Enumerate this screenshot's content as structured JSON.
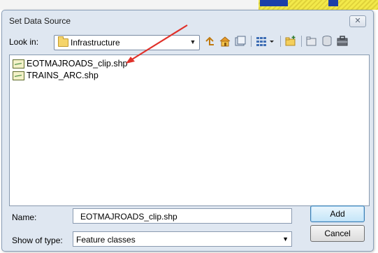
{
  "dialog": {
    "title": "Set Data Source",
    "close_glyph": "✕",
    "look_in": {
      "label": "Look in:",
      "value": "Infrastructure",
      "dropdown_glyph": "▼"
    },
    "toolbar": {
      "icons": [
        "up-one-level-icon",
        "home-icon",
        "catalog-icon",
        "view-menu-icon",
        "new-folder-icon",
        "connect-folder-icon",
        "database-icon",
        "toolbox-icon"
      ]
    },
    "files": [
      {
        "name": "EOTMAJROADS_clip.shp",
        "icon": "line-feature-icon"
      },
      {
        "name": "TRAINS_ARC.shp",
        "icon": "line-feature-icon"
      }
    ],
    "name_field": {
      "label": "Name:",
      "value": "EOTMAJROADS_clip.shp"
    },
    "type_field": {
      "label": "Show of type:",
      "value": "Feature classes",
      "dropdown_glyph": "▼"
    },
    "buttons": {
      "add": "Add",
      "cancel": "Cancel"
    },
    "annotation_color": "#e0312a"
  }
}
